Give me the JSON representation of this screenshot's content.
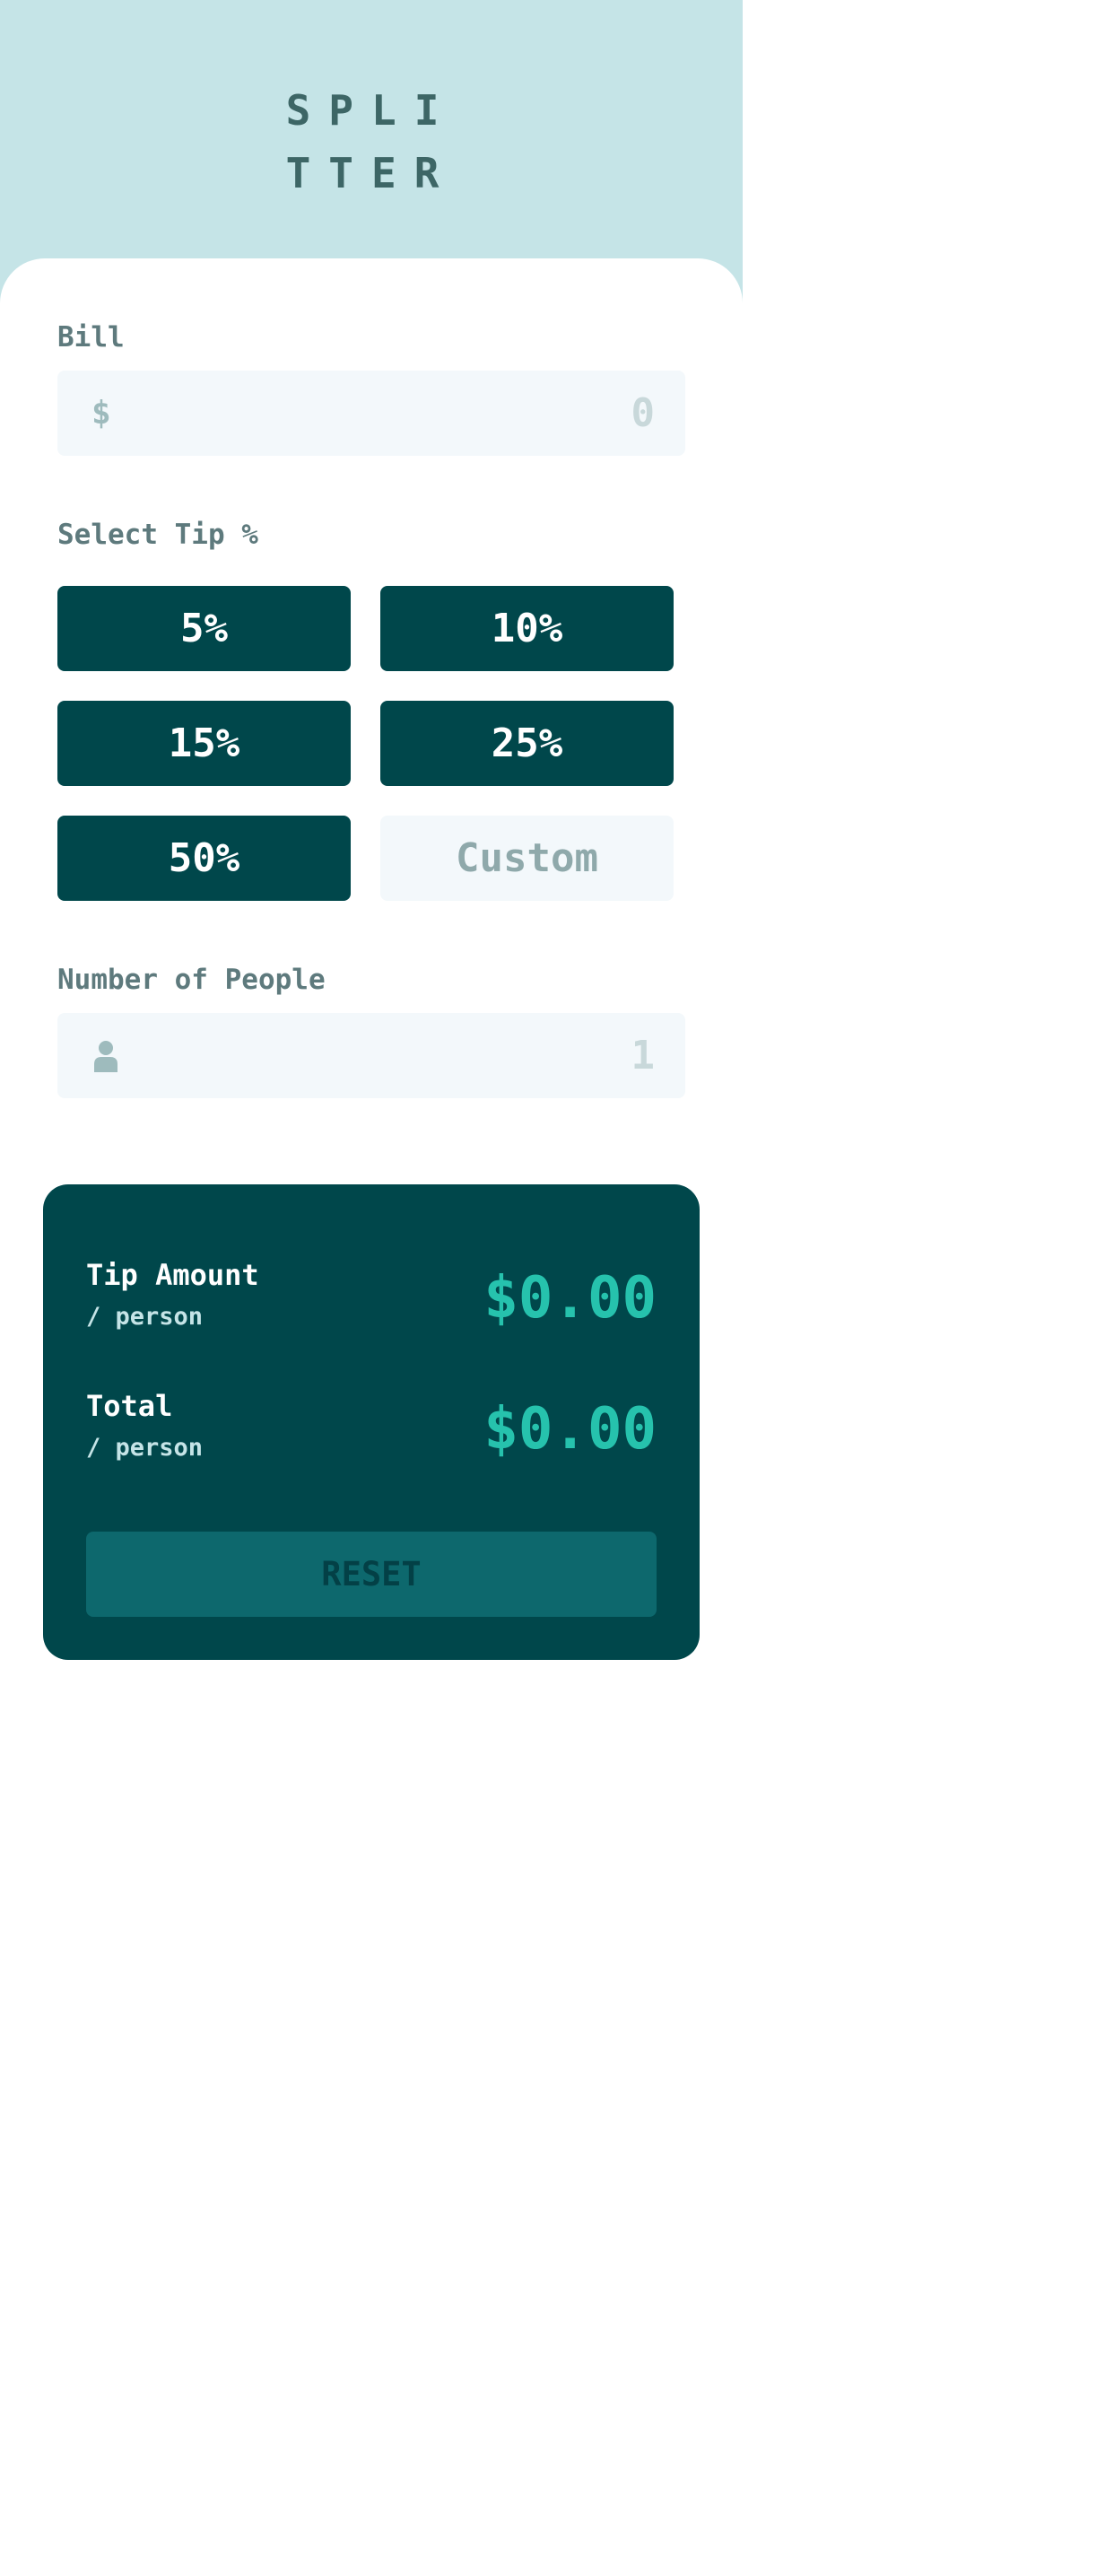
{
  "header": {
    "logo_line1": "SPLI",
    "logo_line2": "TTER"
  },
  "bill": {
    "label": "Bill",
    "currency_symbol": "$",
    "value": "0"
  },
  "tip": {
    "label": "Select Tip %",
    "options": [
      "5%",
      "10%",
      "15%",
      "25%",
      "50%"
    ],
    "custom_placeholder": "Custom"
  },
  "people": {
    "label": "Number of People",
    "icon": "person-icon",
    "value": "1"
  },
  "results": {
    "tip_amount_label": "Tip Amount",
    "tip_amount_sub": "/ person",
    "tip_amount_value": "$0.00",
    "total_label": "Total",
    "total_sub": "/ person",
    "total_value": "$0.00",
    "reset_label": "RESET"
  },
  "colors": {
    "header_bg": "#c5e4e7",
    "dark_teal": "#00474b",
    "accent": "#26c2ad",
    "input_bg": "#f3f8fb",
    "label_text": "#5e7a7d"
  }
}
